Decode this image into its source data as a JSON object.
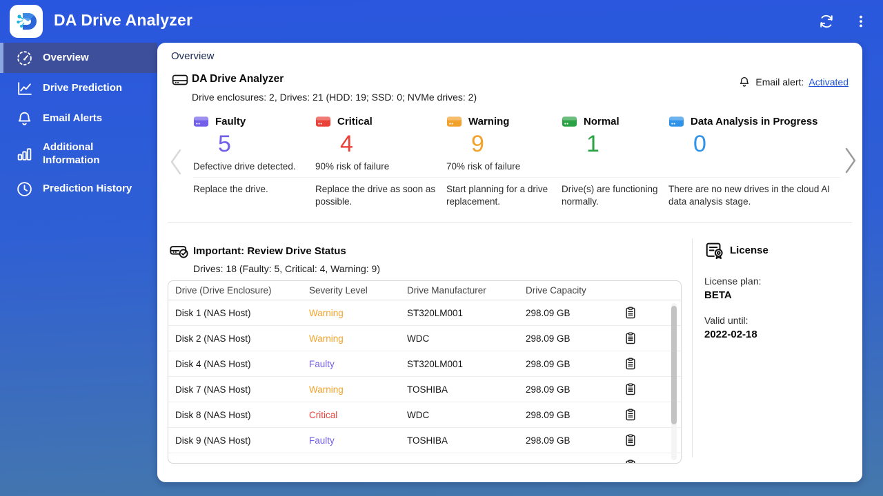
{
  "app": {
    "title": "DA Drive Analyzer"
  },
  "sidebar": {
    "items": [
      {
        "label": "Overview",
        "icon": "gauge-icon"
      },
      {
        "label": "Drive Prediction",
        "icon": "line-chart-icon"
      },
      {
        "label": "Email Alerts",
        "icon": "bell-icon"
      },
      {
        "label": "Additional Information",
        "icon": "bar-chart-icon"
      },
      {
        "label": "Prediction History",
        "icon": "clock-icon"
      }
    ]
  },
  "main": {
    "breadcrumb": "Overview",
    "summary": {
      "title": "DA Drive Analyzer",
      "subtitle": "Drive enclosures: 2, Drives: 21 (HDD: 19; SSD: 0; NVMe drives: 2)"
    },
    "email_alert": {
      "label": "Email alert:",
      "link": "Activated",
      "link_color": "#1a4fd6"
    },
    "status_cards": [
      {
        "label": "Faulty",
        "count": "5",
        "color": "#7360ea",
        "desc1": "Defective drive detected.",
        "desc2": "Replace the drive."
      },
      {
        "label": "Critical",
        "count": "4",
        "color": "#ea4139",
        "desc1": "90% risk of failure",
        "desc2": "Replace the drive as soon as possible."
      },
      {
        "label": "Warning",
        "count": "9",
        "color": "#f2a22b",
        "desc1": "70% risk of failure",
        "desc2": "Start planning for a drive replacement."
      },
      {
        "label": "Normal",
        "count": "1",
        "color": "#2ba345",
        "desc1": "",
        "desc2": "Drive(s) are functioning normally."
      },
      {
        "label": "Data Analysis in Progress",
        "count": "0",
        "color": "#2f93ea",
        "desc1": "",
        "desc2": "There are no new drives in the cloud AI data analysis stage."
      }
    ]
  },
  "review": {
    "title": "Important: Review Drive Status",
    "subtitle": "Drives: 18 (Faulty: 5, Critical: 4, Warning: 9)",
    "table": {
      "columns": [
        "Drive (Drive Enclosure)",
        "Severity Level",
        "Drive Manufacturer",
        "Drive Capacity"
      ],
      "rows": [
        {
          "drive": "Disk 1 (NAS Host)",
          "severity": "Warning",
          "color": "#f2a22b",
          "manufacturer": "ST320LM001",
          "capacity": "298.09 GB"
        },
        {
          "drive": "Disk 2 (NAS Host)",
          "severity": "Warning",
          "color": "#f2a22b",
          "manufacturer": "WDC",
          "capacity": "298.09 GB"
        },
        {
          "drive": "Disk 4 (NAS Host)",
          "severity": "Faulty",
          "color": "#7360ea",
          "manufacturer": "ST320LM001",
          "capacity": "298.09 GB"
        },
        {
          "drive": "Disk 7 (NAS Host)",
          "severity": "Warning",
          "color": "#f2a22b",
          "manufacturer": "TOSHIBA",
          "capacity": "298.09 GB"
        },
        {
          "drive": "Disk 8 (NAS Host)",
          "severity": "Critical",
          "color": "#ea4139",
          "manufacturer": "WDC",
          "capacity": "298.09 GB"
        },
        {
          "drive": "Disk 9 (NAS Host)",
          "severity": "Faulty",
          "color": "#7360ea",
          "manufacturer": "TOSHIBA",
          "capacity": "298.09 GB"
        }
      ]
    }
  },
  "license": {
    "title": "License",
    "plan_label": "License plan:",
    "plan": "BETA",
    "valid_label": "Valid until:",
    "valid": "2022-02-18"
  }
}
